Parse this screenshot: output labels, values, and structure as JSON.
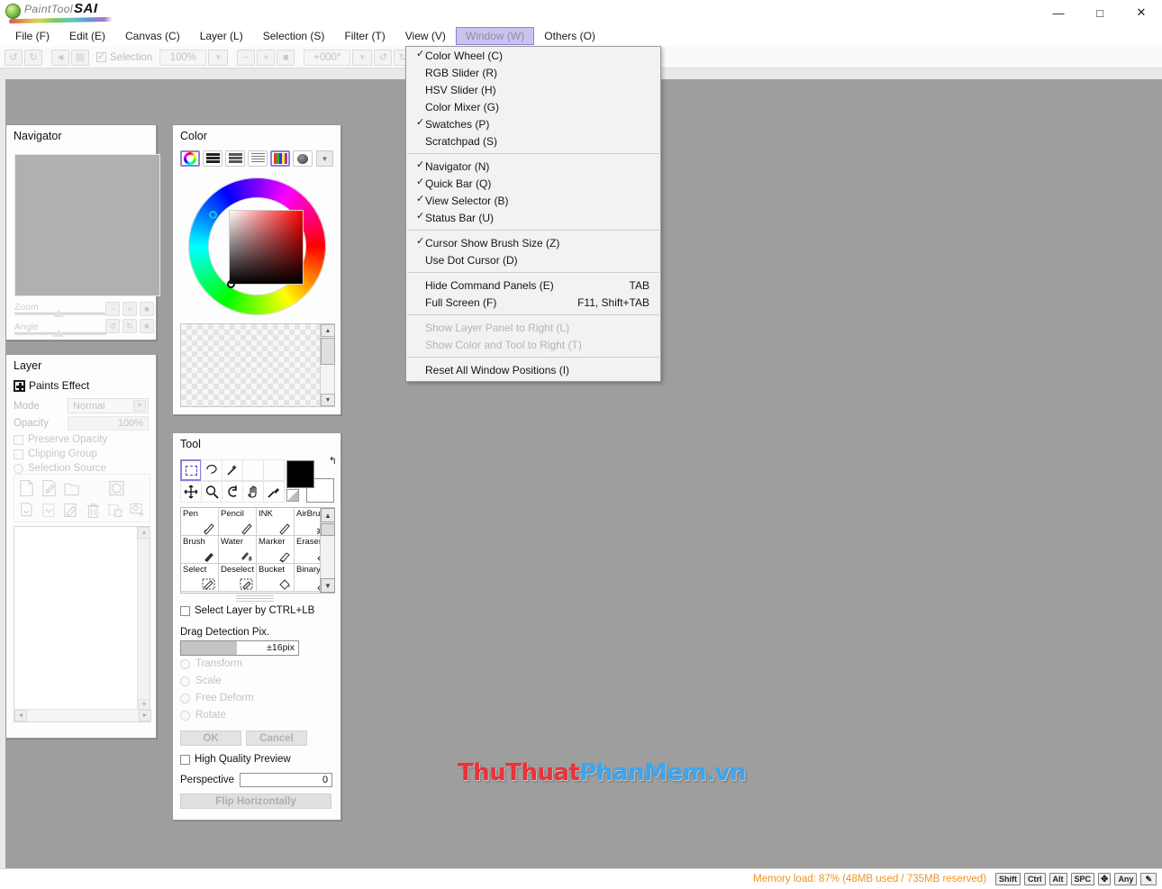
{
  "app": {
    "logo_name": "PaintTool",
    "logo_sai": "SAI"
  },
  "window_controls": {
    "minimize": "—",
    "maximize": "□",
    "close": "✕"
  },
  "menubar": {
    "items": [
      {
        "label": "File (F)",
        "active": false
      },
      {
        "label": "Edit (E)",
        "active": false
      },
      {
        "label": "Canvas (C)",
        "active": false
      },
      {
        "label": "Layer (L)",
        "active": false
      },
      {
        "label": "Selection (S)",
        "active": false
      },
      {
        "label": "Filter (T)",
        "active": false
      },
      {
        "label": "View (V)",
        "active": false
      },
      {
        "label": "Window (W)",
        "active": true
      },
      {
        "label": "Others (O)",
        "active": false
      }
    ]
  },
  "quickbar": {
    "undo_icon": "↺",
    "redo_icon": "↻",
    "back_icon": "◄",
    "forward_icon": "▤",
    "selection_label": "Selection",
    "zoom_value": "100%",
    "zoom_out": "−",
    "zoom_in": "+",
    "zoom_reset": "■",
    "angle_value": "+000°",
    "rot_ccw": "↺",
    "rot_cw": "↻",
    "rot_reset": "■",
    "dropdown_arrow": "▼"
  },
  "navigator": {
    "title": "Navigator",
    "zoom_label": "Zoom",
    "angle_label": "Angle",
    "buttons": [
      "−",
      "+",
      "■",
      "↺",
      "↻",
      "■"
    ]
  },
  "layer_panel": {
    "title": "Layer",
    "paints_effect": "Paints Effect",
    "mode_label": "Mode",
    "mode_value": "Normal",
    "opacity_label": "Opacity",
    "opacity_value": "100%",
    "preserve_opacity": "Preserve Opacity",
    "clipping_group": "Clipping Group",
    "selection_source": "Selection Source",
    "action_icons_row1": [
      "new-layer-icon",
      "new-linework-layer-icon",
      "new-folder-icon",
      "",
      "layer-mask-icon"
    ],
    "action_icons_row2": [
      "copy-layer-icon",
      "merge-down-icon",
      "clear-layer-icon",
      "delete-layer-icon",
      "merge-icon",
      "add-mask-icon"
    ],
    "scroll_up": "▲",
    "scroll_down": "▼",
    "scroll_left": "◄",
    "scroll_right": "►"
  },
  "color_panel": {
    "title": "Color",
    "modes": [
      {
        "name": "color-wheel-icon",
        "selected": true
      },
      {
        "name": "rgb-slider-icon",
        "selected": false
      },
      {
        "name": "hsv-slider-icon",
        "selected": false
      },
      {
        "name": "color-mixer-icon",
        "selected": false
      },
      {
        "name": "swatches-icon",
        "selected": true
      },
      {
        "name": "scratchpad-icon",
        "selected": false
      }
    ],
    "dropdown_arrow": "▼",
    "scroll_up": "▲",
    "scroll_down": "▼"
  },
  "tool_panel": {
    "title": "Tool",
    "tools_row1": [
      "rect-select-icon",
      "lasso-select-icon",
      "magic-wand-icon",
      "",
      ""
    ],
    "tools_row2": [
      "move-icon",
      "zoom-icon",
      "rotate-icon",
      "hand-icon",
      "eyedropper-icon"
    ],
    "tool_glyphs_row1": [
      "⬚",
      "◠",
      "✦",
      "",
      ""
    ],
    "tool_glyphs_row2": [
      "✥",
      "🔍",
      "↻",
      "✋",
      "✎"
    ],
    "swap_arrow": "↰",
    "brushes": [
      [
        {
          "name": "Pen",
          "glyph": "✎"
        },
        {
          "name": "Pencil",
          "glyph": "✏"
        },
        {
          "name": "INK",
          "glyph": "✎"
        },
        {
          "name": "AirBrush",
          "glyph": "✄"
        }
      ],
      [
        {
          "name": "Brush",
          "glyph": "🖌"
        },
        {
          "name": "Water",
          "glyph": "💧"
        },
        {
          "name": "Marker",
          "glyph": "🖊"
        },
        {
          "name": "Eraser",
          "glyph": "◇"
        }
      ],
      [
        {
          "name": "Select",
          "glyph": "⬚"
        },
        {
          "name": "Deselect",
          "glyph": "⬚"
        },
        {
          "name": "Bucket",
          "glyph": "🪣"
        },
        {
          "name": "Binary",
          "glyph": "✎"
        }
      ]
    ],
    "scroll_up": "▲",
    "scroll_down": "▼",
    "select_layer_ctrl": "Select Layer by CTRL+LB",
    "drag_detection_label": "Drag Detection Pix.",
    "drag_detection_value": "±16pix",
    "transform": "Transform",
    "scale": "Scale",
    "free_deform": "Free Deform",
    "rotate": "Rotate",
    "ok": "OK",
    "cancel": "Cancel",
    "high_quality_preview": "High Quality Preview",
    "perspective_label": "Perspective",
    "perspective_value": "0",
    "flip_horizontally": "Flip Horizontally"
  },
  "window_menu": {
    "groups": [
      [
        {
          "label": "Color Wheel (C)",
          "checked": true,
          "accel": "",
          "disabled": false
        },
        {
          "label": "RGB Slider (R)",
          "checked": false,
          "accel": "",
          "disabled": false
        },
        {
          "label": "HSV Slider (H)",
          "checked": false,
          "accel": "",
          "disabled": false
        },
        {
          "label": "Color Mixer (G)",
          "checked": false,
          "accel": "",
          "disabled": false
        },
        {
          "label": "Swatches (P)",
          "checked": true,
          "accel": "",
          "disabled": false
        },
        {
          "label": "Scratchpad (S)",
          "checked": false,
          "accel": "",
          "disabled": false
        }
      ],
      [
        {
          "label": "Navigator (N)",
          "checked": true,
          "accel": "",
          "disabled": false
        },
        {
          "label": "Quick Bar (Q)",
          "checked": true,
          "accel": "",
          "disabled": false
        },
        {
          "label": "View Selector (B)",
          "checked": true,
          "accel": "",
          "disabled": false
        },
        {
          "label": "Status Bar (U)",
          "checked": true,
          "accel": "",
          "disabled": false
        }
      ],
      [
        {
          "label": "Cursor Show Brush Size (Z)",
          "checked": true,
          "accel": "",
          "disabled": false
        },
        {
          "label": "Use Dot Cursor (D)",
          "checked": false,
          "accel": "",
          "disabled": false
        }
      ],
      [
        {
          "label": "Hide Command Panels (E)",
          "checked": false,
          "accel": "TAB",
          "disabled": false
        },
        {
          "label": "Full Screen (F)",
          "checked": false,
          "accel": "F11, Shift+TAB",
          "disabled": false
        }
      ],
      [
        {
          "label": "Show Layer Panel to Right (L)",
          "checked": false,
          "accel": "",
          "disabled": true
        },
        {
          "label": "Show Color and Tool to Right (T)",
          "checked": false,
          "accel": "",
          "disabled": true
        }
      ],
      [
        {
          "label": "Reset All Window Positions (I)",
          "checked": false,
          "accel": "",
          "disabled": false
        }
      ]
    ],
    "check_glyph": "✓"
  },
  "watermark": {
    "part1": "ThuThuat",
    "part2": "PhanMem.vn"
  },
  "statusbar": {
    "memory": "Memory load: 87% (48MB used / 735MB reserved)",
    "keys": [
      "Shift",
      "Ctrl",
      "Alt",
      "SPC"
    ],
    "dpad": "✥",
    "any": "Any",
    "pen": "✎"
  },
  "colors": {
    "accent_purple": "#8d82d8",
    "menu_highlight": "#c9c3f0",
    "memory_orange": "#f2921f",
    "canvas_gray": "#9e9e9e",
    "watermark_red": "#e8333a",
    "watermark_blue": "#3aa6ef"
  }
}
